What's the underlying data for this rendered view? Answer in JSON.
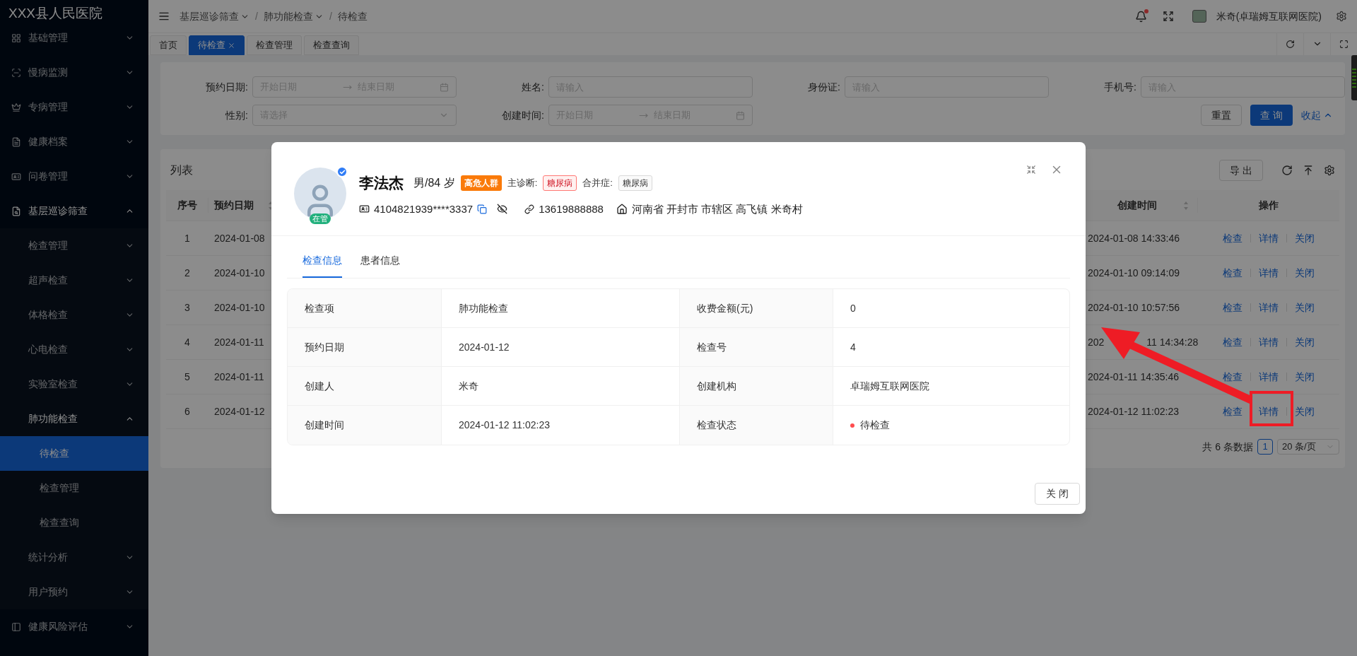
{
  "sidebar": {
    "title": "XXX县人民医院",
    "items": [
      {
        "label": "基础管理",
        "expanded": false
      },
      {
        "label": "慢病监测",
        "expanded": false
      },
      {
        "label": "专病管理",
        "expanded": false
      },
      {
        "label": "健康档案",
        "expanded": false
      },
      {
        "label": "问卷管理",
        "expanded": false
      },
      {
        "label": "基层巡诊筛查",
        "expanded": true,
        "children": [
          {
            "label": "检查管理",
            "expanded": false
          },
          {
            "label": "超声检查",
            "expanded": false
          },
          {
            "label": "体格检查",
            "expanded": false
          },
          {
            "label": "心电检查",
            "expanded": false
          },
          {
            "label": "实验室检查",
            "expanded": false
          },
          {
            "label": "肺功能检查",
            "expanded": true,
            "children": [
              {
                "label": "待检查",
                "selected": true
              },
              {
                "label": "检查管理",
                "selected": false
              },
              {
                "label": "检查查询",
                "selected": false
              }
            ]
          },
          {
            "label": "统计分析",
            "expanded": false
          },
          {
            "label": "用户预约",
            "expanded": false
          }
        ]
      },
      {
        "label": "健康风险评估",
        "expanded": false
      }
    ]
  },
  "header": {
    "separator": "/",
    "breadcrumb": [
      {
        "label": "基层巡诊筛查",
        "dropdown": true
      },
      {
        "label": "肺功能检查",
        "dropdown": true
      },
      {
        "label": "待检查",
        "dropdown": false
      }
    ],
    "unread": true,
    "user": "米奇(卓瑞姆互联网医院)"
  },
  "page_tabs": [
    {
      "label": "首页",
      "selected": false,
      "closable": false
    },
    {
      "label": "待检查",
      "selected": true,
      "closable": true
    },
    {
      "label": "检查管理",
      "selected": false,
      "closable": false
    },
    {
      "label": "检查查询",
      "selected": false,
      "closable": false
    }
  ],
  "filters": [
    {
      "kind": "range",
      "label": "预约日期:",
      "start_placeholder": "开始日期",
      "end_placeholder": "结束日期"
    },
    {
      "kind": "text",
      "label": "姓名:",
      "placeholder": "请输入"
    },
    {
      "kind": "text",
      "label": "身份证:",
      "placeholder": "请输入"
    },
    {
      "kind": "text",
      "label": "手机号:",
      "placeholder": "请输入"
    },
    {
      "kind": "select",
      "label": "性别:",
      "placeholder": "请选择"
    },
    {
      "kind": "range",
      "label": "创建时间:",
      "start_placeholder": "开始日期",
      "end_placeholder": "结束日期"
    }
  ],
  "filter_buttons": {
    "reset": "重置",
    "search": "查 询",
    "collapse": "收起"
  },
  "list": {
    "title": "列表",
    "export": "导 出",
    "columns": [
      {
        "label": "序号",
        "sortable": false
      },
      {
        "label": "预约日期",
        "sortable": true
      },
      {
        "label": "创建时间",
        "sortable": true
      },
      {
        "label": "操作",
        "sortable": false
      }
    ],
    "rows": [
      {
        "no": "1",
        "date": "2024-01-08",
        "created": "2024-01-08 14:33:46",
        "actions": [
          "检查",
          "详情",
          "关闭"
        ]
      },
      {
        "no": "2",
        "date": "2024-01-10",
        "created": "2024-01-10 09:14:09",
        "actions": [
          "检查",
          "详情",
          "关闭"
        ]
      },
      {
        "no": "3",
        "date": "2024-01-10",
        "created": "2024-01-10 10:57:56",
        "actions": [
          "检查",
          "详情",
          "关闭"
        ]
      },
      {
        "no": "4",
        "date": "2024-01-11",
        "created": "202",
        "created_after_arrow": "11 14:34:28",
        "actions": [
          "检查",
          "详情",
          "关闭"
        ]
      },
      {
        "no": "5",
        "date": "2024-01-11",
        "created": "2024-01-11 14:35:46",
        "actions": [
          "检查",
          "详情",
          "关闭"
        ]
      },
      {
        "no": "6",
        "date": "2024-01-12",
        "created": "2024-01-12 11:02:23",
        "actions": [
          "检查",
          "详情",
          "关闭"
        ]
      }
    ],
    "total": "共 6 条数据",
    "page": "1",
    "page_size": "20 条/页"
  },
  "modal": {
    "patient": {
      "name": "李法杰",
      "gender_age": "男/84 岁",
      "status_tag": "在管",
      "verified": true,
      "badges": [
        {
          "kind": "risk",
          "text": "高危人群"
        },
        {
          "kind": "caption",
          "text": "主诊断:"
        },
        {
          "kind": "danger",
          "text": "糖尿病"
        },
        {
          "kind": "caption",
          "text": "合并症:"
        },
        {
          "kind": "plain",
          "text": "糖尿病"
        }
      ],
      "id_number": "4104821939****3337",
      "phone": "13619888888",
      "address": "河南省 开封市 市辖区 高飞镇 米奇村"
    },
    "tabs": [
      {
        "label": "检查信息",
        "selected": true
      },
      {
        "label": "患者信息",
        "selected": false
      }
    ],
    "details": [
      {
        "label": "检查项",
        "value": "肺功能检查"
      },
      {
        "label": "收费金额(元)",
        "value": "0"
      },
      {
        "label": "预约日期",
        "value": "2024-01-12"
      },
      {
        "label": "检查号",
        "value": "4"
      },
      {
        "label": "创建人",
        "value": "米奇"
      },
      {
        "label": "创建机构",
        "value": "卓瑞姆互联网医院"
      },
      {
        "label": "创建时间",
        "value": "2024-01-12 11:02:23"
      },
      {
        "label": "检查状态",
        "value": "待检查",
        "kind": "status",
        "color": "#ff4d4f"
      }
    ],
    "close": "关 闭"
  }
}
